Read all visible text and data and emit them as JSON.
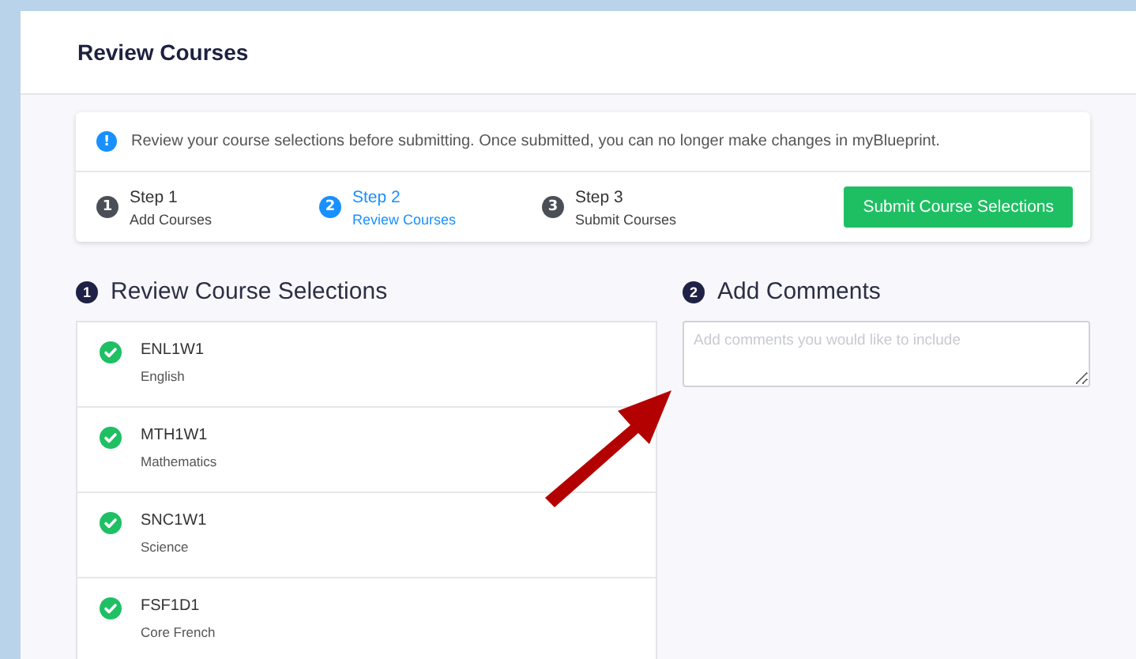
{
  "page": {
    "title": "Review Courses"
  },
  "notice": {
    "text": "Review your course selections before submitting. Once submitted, you can no longer make changes in myBlueprint.",
    "icon": "!"
  },
  "steps": [
    {
      "number": "1",
      "title": "Step 1",
      "subtitle": "Add Courses",
      "selected": false
    },
    {
      "number": "2",
      "title": "Step 2",
      "subtitle": "Review Courses",
      "selected": true
    },
    {
      "number": "3",
      "title": "Step 3",
      "subtitle": "Submit Courses",
      "selected": false
    }
  ],
  "submit_button": "Submit Course Selections",
  "review_section": {
    "number": "1",
    "heading": "Review Course Selections",
    "courses": [
      {
        "code": "ENL1W1",
        "name": "English",
        "checked": true
      },
      {
        "code": "MTH1W1",
        "name": "Mathematics",
        "checked": true
      },
      {
        "code": "SNC1W1",
        "name": "Science",
        "checked": true
      },
      {
        "code": "FSF1D1",
        "name": "Core French",
        "checked": true
      }
    ]
  },
  "comments_section": {
    "number": "2",
    "heading": "Add Comments",
    "placeholder": "Add comments you would like to include"
  }
}
